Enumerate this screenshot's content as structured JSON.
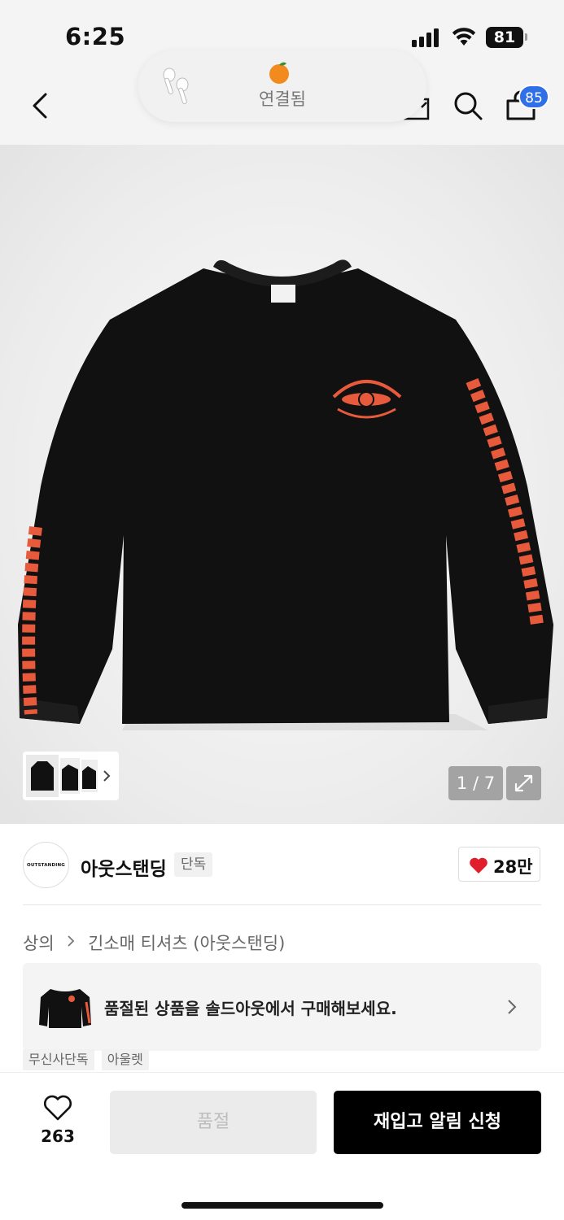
{
  "status_bar": {
    "time": "6:25",
    "battery": "81"
  },
  "nav": {
    "cart_badge": "85"
  },
  "popup": {
    "status": "연결됨"
  },
  "gallery": {
    "pager": "1 / 7"
  },
  "brand": {
    "logo_text": "OUTSTANDING",
    "name": "아웃스탠딩",
    "badge": "단독",
    "likes": "28만"
  },
  "breadcrumb": {
    "parent": "상의",
    "current": "긴소매 티셔츠 (아웃스탠딩)"
  },
  "soldout_card": {
    "text": "품절된 상품을 솔드아웃에서 구매해보세요."
  },
  "tags": [
    "무신사단독",
    "아울렛"
  ],
  "bottom_bar": {
    "wish_count": "263",
    "soldout_label": "품절",
    "restock_label": "재입고 알림 신청"
  },
  "colors": {
    "accent_badge": "#2f6fe8",
    "like_red": "#e01e2c",
    "print_orange": "#e85a3c"
  }
}
